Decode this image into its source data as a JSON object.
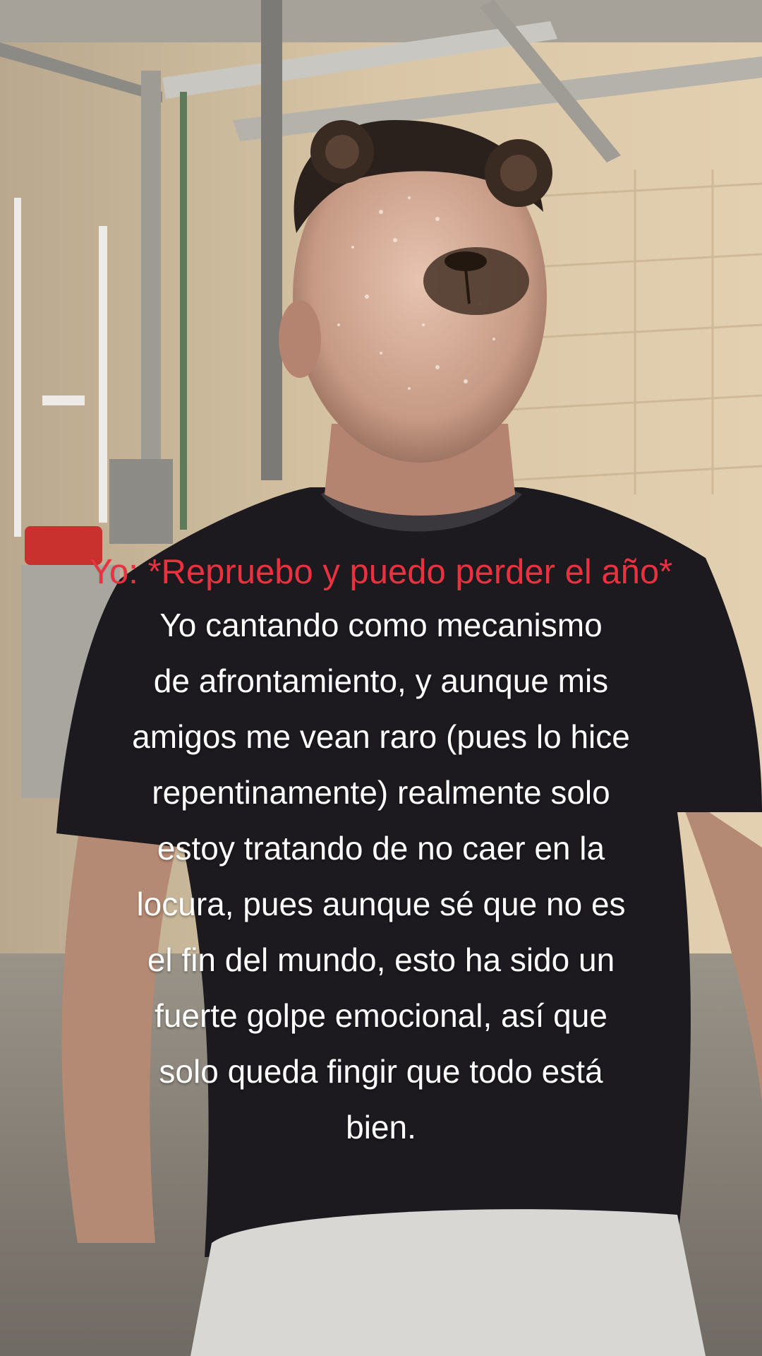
{
  "caption": {
    "highlight": "Yo: *Repruebo y puedo perder el año*",
    "lines": [
      "Yo cantando como mecanismo",
      "de afrontamiento, y aunque mis",
      "amigos me vean raro (pues lo hice",
      "repentinamente) realmente solo",
      "estoy tratando de no caer en la",
      "locura, pues aunque sé que no es",
      "el fin del mundo, esto ha sido un",
      "fuerte golpe emocional, así que",
      "solo queda fingir que todo está",
      "bien."
    ]
  },
  "colors": {
    "highlight_text": "#e8323f",
    "body_text": "#ffffff",
    "wall": "#d8c2a0",
    "shirt": "#1c1a1f"
  }
}
